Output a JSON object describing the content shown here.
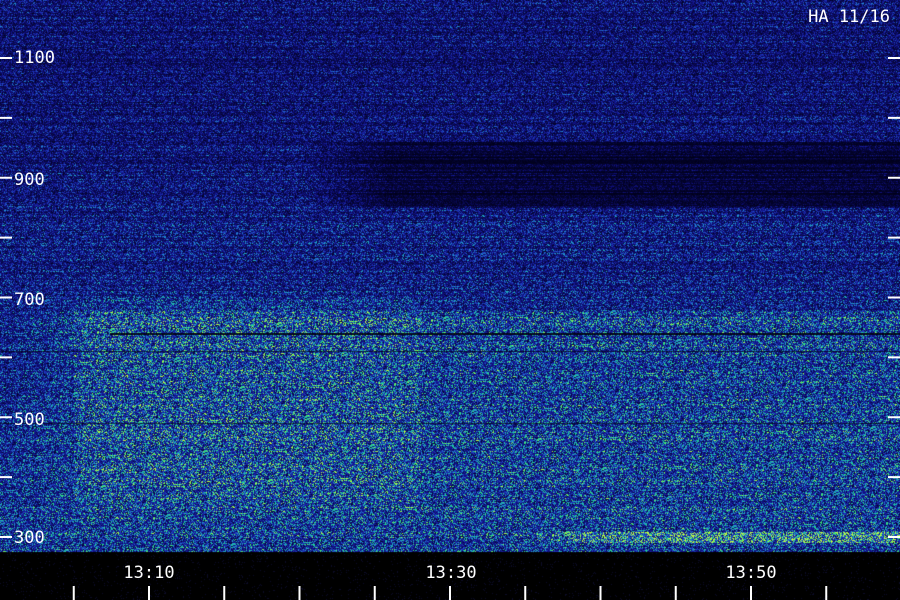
{
  "chart_data": {
    "type": "heatmap",
    "title": "HA 11/16",
    "x": {
      "tick_labels": [
        "13:10",
        "13:30",
        "13:50"
      ],
      "range": [
        "13:01",
        "14:00"
      ],
      "minor_tick_step_minutes": 5
    },
    "y": {
      "tick_labels": [
        "1100",
        "900",
        "700",
        "500",
        "300"
      ],
      "major_ticks": [
        1100,
        1000,
        900,
        800,
        700,
        600,
        500,
        400,
        300
      ],
      "range": [
        290,
        1160
      ]
    },
    "colormap": [
      "#000018",
      "#101080",
      "#2038c0",
      "#20a0d0",
      "#20e080",
      "#c0ff40"
    ],
    "features": [
      {
        "name": "depletion band",
        "y_range": [
          850,
          960
        ],
        "x_range": [
          "13:20",
          "14:00"
        ],
        "level": 0.1
      },
      {
        "name": "enhanced lower band",
        "y_range": [
          300,
          680
        ],
        "x_range": [
          "13:01",
          "14:00"
        ],
        "level": 0.55
      },
      {
        "name": "bright floor",
        "y_range": [
          290,
          310
        ],
        "x_range": [
          "13:35",
          "14:00"
        ],
        "level": 0.95
      }
    ]
  }
}
